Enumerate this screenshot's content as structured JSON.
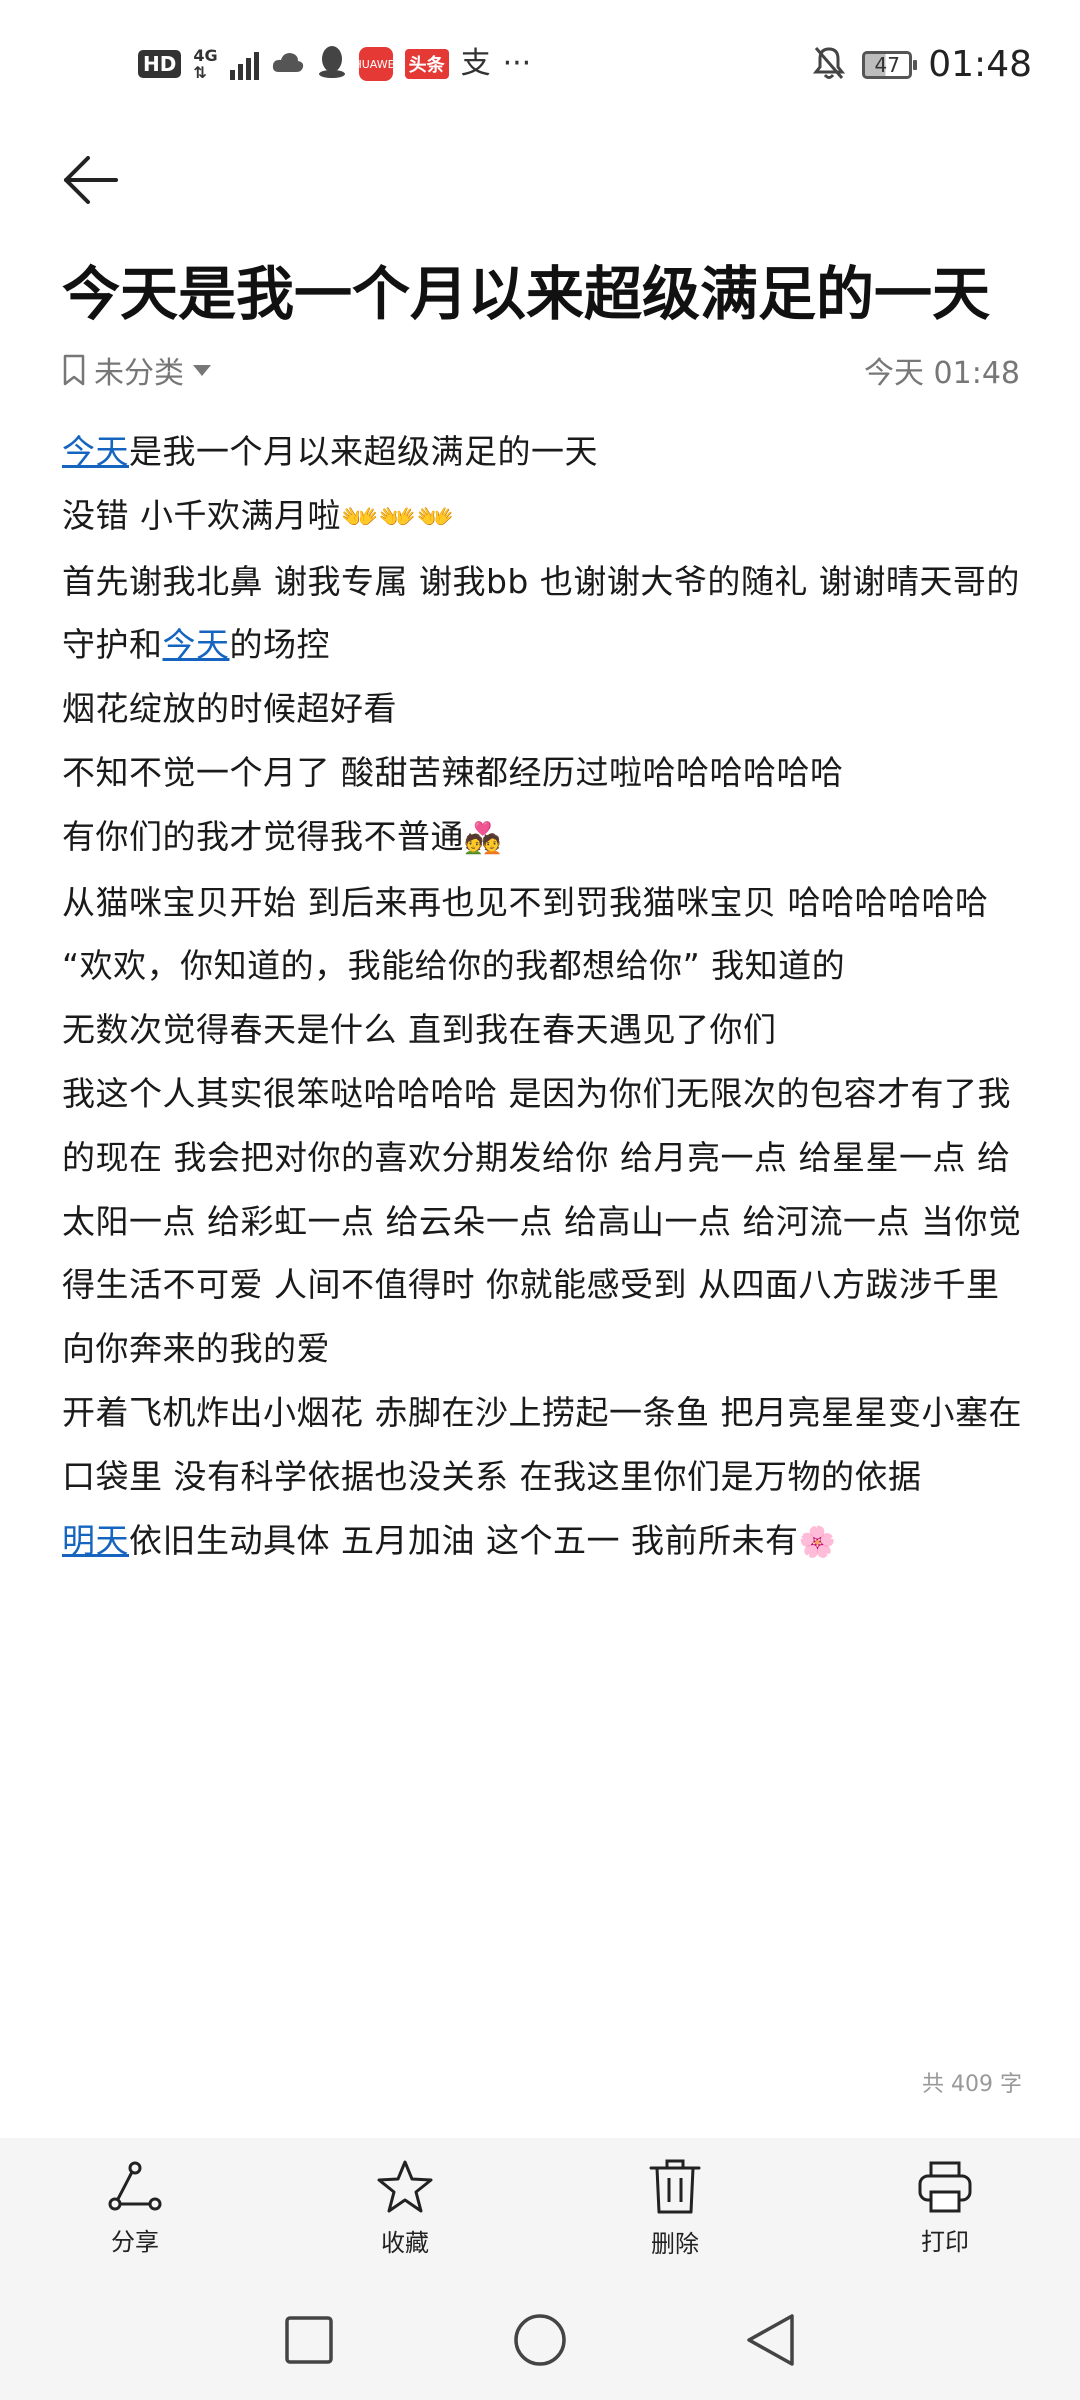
{
  "status_bar": {
    "hd": "HD",
    "network_top": "4G",
    "network_bottom": "⇅",
    "app_badge": "HUAWEI",
    "toutiao": "头条",
    "zhi": "支",
    "more": "···",
    "battery": "47",
    "time": "01:48"
  },
  "note": {
    "title": "今天是我一个月以来超级满足的一天",
    "category": "未分类",
    "timestamp": "今天 01:48",
    "word_count": "共 409 字"
  },
  "content": {
    "l1_link": "今天",
    "l1_rest": "是我一个月以来超级满足的一天",
    "l2": "没错 小千欢满月啦",
    "l2_emoji": "👐👐👐",
    "l3_a": "首先谢我北鼻 谢我专属 谢我bb 也谢谢大爷的随礼 谢谢晴天哥的守护和",
    "l3_link": "今天",
    "l3_b": "的场控",
    "l4": "烟花绽放的时候超好看",
    "l5": "不知不觉一个月了 酸甜苦辣都经历过啦哈哈哈哈哈哈",
    "l6": "有你们的我才觉得我不普通",
    "l6_emoji": "💑",
    "l7": "从猫咪宝贝开始 到后来再也见不到罚我猫咪宝贝 哈哈哈哈哈哈",
    "l8": "“欢欢，你知道的，我能给你的我都想给你” 我知道的",
    "l9": "无数次觉得春天是什么 直到我在春天遇见了你们",
    "l10": "我这个人其实很笨哒哈哈哈哈 是因为你们无限次的包容才有了我的现在 我会把对你的喜欢分期发给你 给月亮一点 给星星一点 给太阳一点 给彩虹一点 给云朵一点 给高山一点 给河流一点 当你觉得生活不可爱 人间不值得时 你就能感受到 从四面八方跋涉千里向你奔来的我的爱",
    "l11": "开着飞机炸出小烟花 赤脚在沙上捞起一条鱼 把月亮星星变小塞在口袋里 没有科学依据也没关系 在我这里你们是万物的依据",
    "l12_link": "明天",
    "l12_rest": "依旧生动具体 五月加油 这个五一 我前所未有",
    "l12_emoji": "🌸"
  },
  "toolbar": {
    "share": "分享",
    "favorite": "收藏",
    "delete": "删除",
    "print": "打印"
  },
  "colors": {
    "link": "#1565c0",
    "toolbar_bg": "#f5f5f5"
  },
  "icons": [
    "back-arrow-icon",
    "bookmark-icon",
    "dropdown-icon",
    "share-icon",
    "star-icon",
    "trash-icon",
    "printer-icon",
    "nav-square-icon",
    "nav-circle-icon",
    "nav-triangle-icon"
  ]
}
